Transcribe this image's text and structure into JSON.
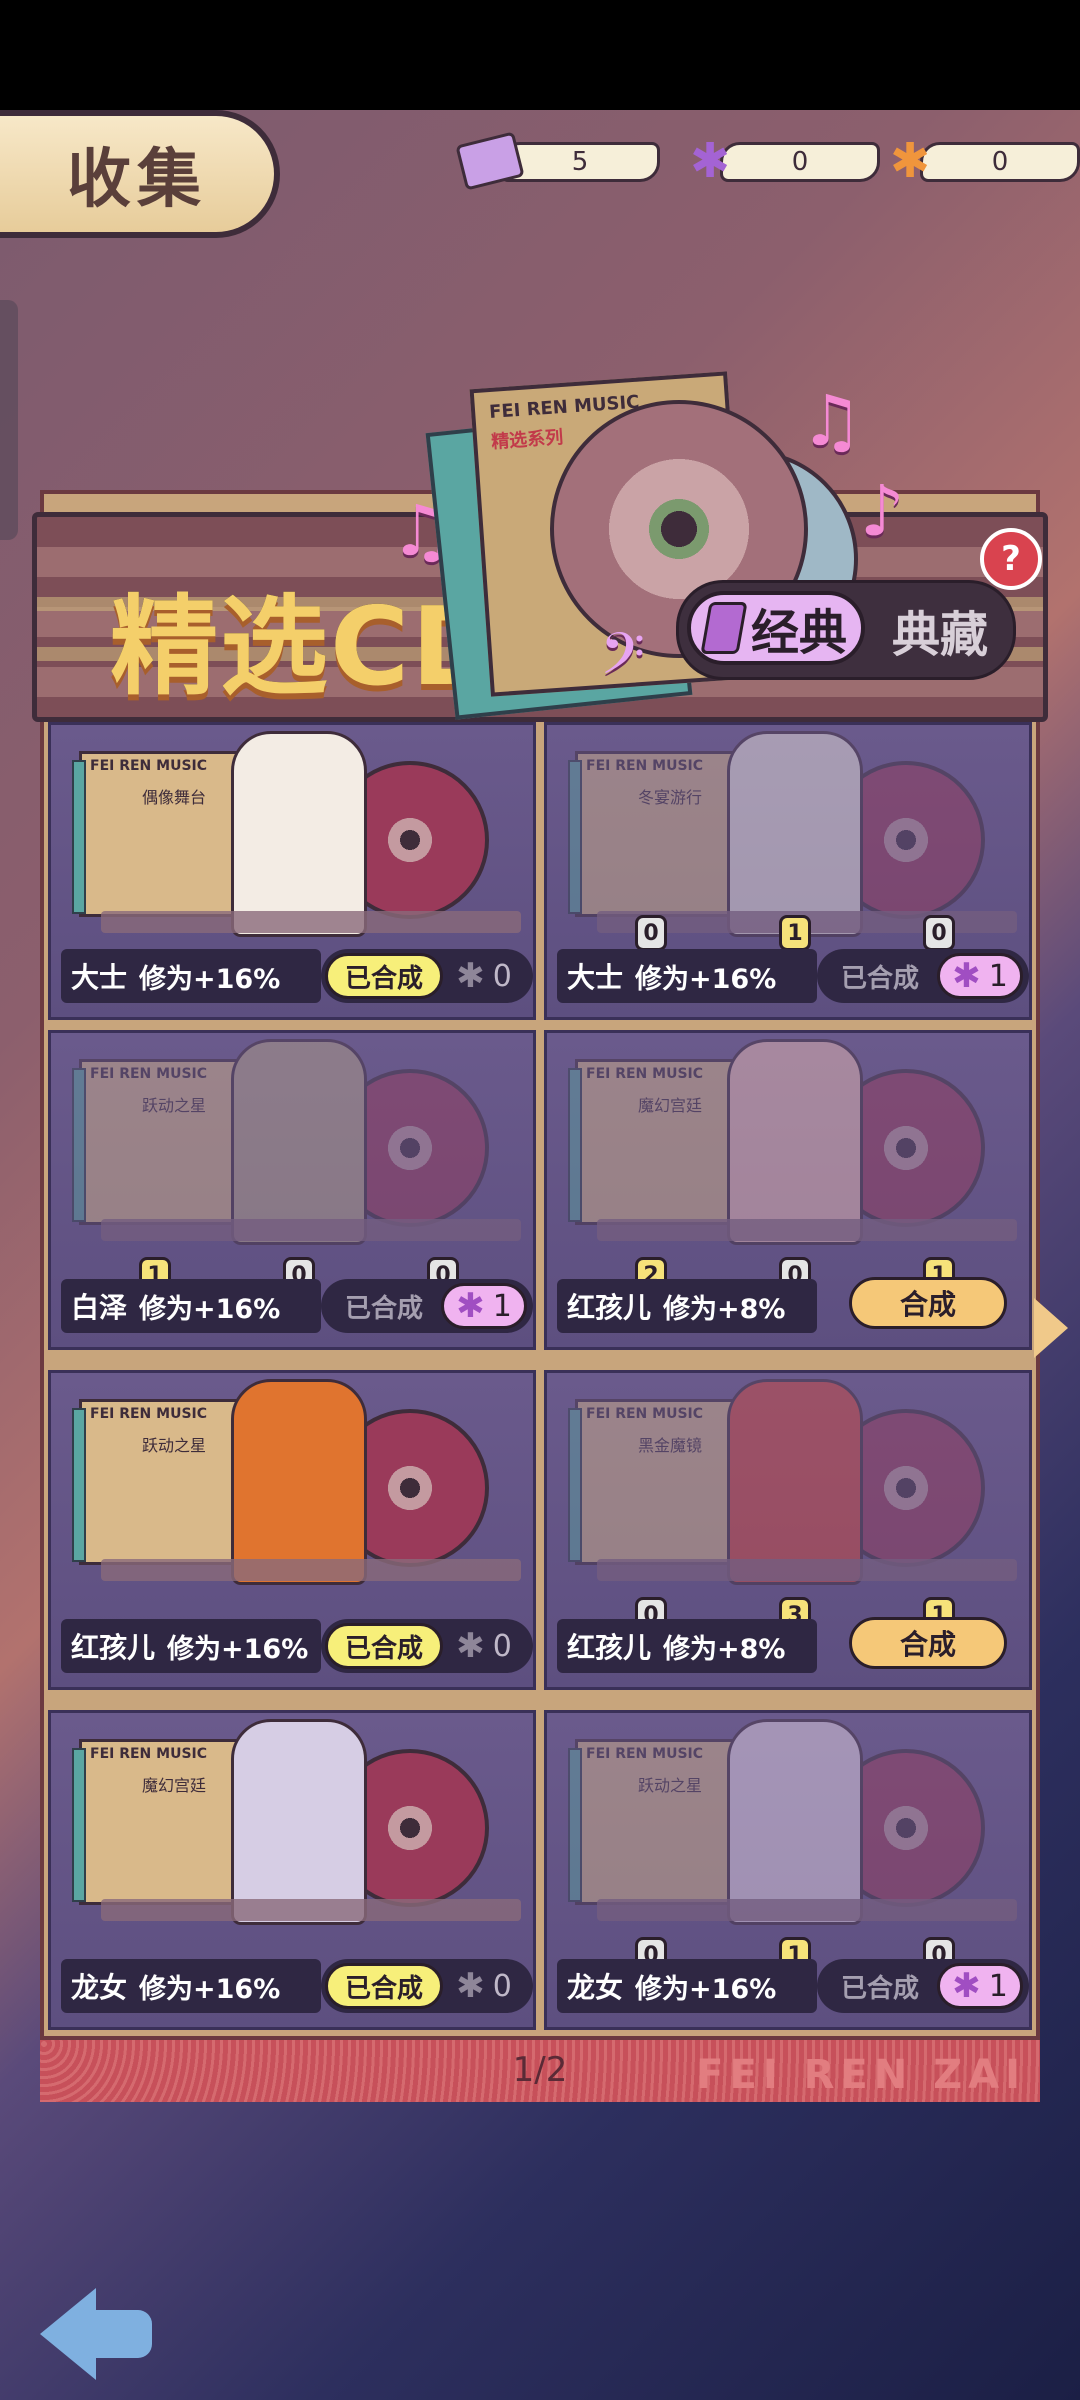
{
  "header": {
    "title": "收集",
    "currencies": [
      {
        "icon": "ticket-icon",
        "value": "5"
      },
      {
        "icon": "puzzle-purple-icon",
        "value": "0"
      },
      {
        "icon": "puzzle-orange-icon",
        "value": "0"
      }
    ]
  },
  "banner": {
    "title": "精选CD",
    "cd_label": "FEI REN MUSIC",
    "cd_sub": "精选系列",
    "tabs": [
      "经典",
      "典藏"
    ],
    "help": "?"
  },
  "cards": [
    {
      "album": "偶像舞台",
      "name": "大士",
      "bonus": "修为+16%",
      "status": "已合成",
      "pieces": "0",
      "counts": []
    },
    {
      "album": "冬宴游行",
      "name": "大士",
      "bonus": "修为+16%",
      "status": "已合成",
      "pieces": "1",
      "counts": [
        "0",
        "1",
        "0"
      ]
    },
    {
      "album": "跃动之星",
      "name": "白泽",
      "bonus": "修为+16%",
      "status": "已合成",
      "pieces": "1",
      "counts": [
        "1",
        "0",
        "0"
      ]
    },
    {
      "album": "魔幻宫廷",
      "name": "红孩儿",
      "bonus": "修为+8%",
      "status": "合成",
      "counts": [
        "2",
        "0",
        "1"
      ]
    },
    {
      "album": "跃动之星",
      "name": "红孩儿",
      "bonus": "修为+16%",
      "status": "已合成",
      "pieces": "0",
      "counts": []
    },
    {
      "album": "黑金魔镜",
      "name": "红孩儿",
      "bonus": "修为+8%",
      "status": "合成",
      "counts": [
        "0",
        "3",
        "1"
      ]
    },
    {
      "album": "魔幻宫廷",
      "name": "龙女",
      "bonus": "修为+16%",
      "status": "已合成",
      "pieces": "0",
      "counts": []
    },
    {
      "album": "跃动之星",
      "name": "龙女",
      "bonus": "修为+16%",
      "status": "已合成",
      "pieces": "1",
      "counts": [
        "0",
        "1",
        "0"
      ]
    }
  ],
  "footer": {
    "page": "1/2",
    "brand": "FEI REN ZAI"
  }
}
